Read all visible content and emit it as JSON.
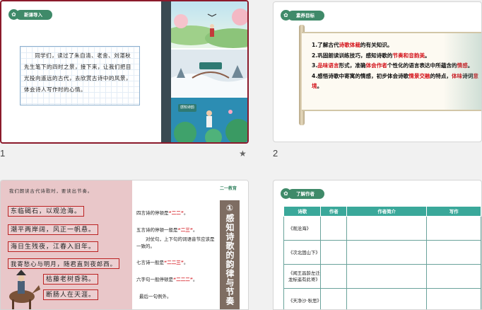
{
  "slides": [
    {
      "number": "1",
      "badge": "新课导入",
      "intro_text": "同学们，读过了朱自清、老舍、刘湛秋先生笔下的四时之景，接下来，让我们把目光投向遥远的古代，去欣赏古诗中的风景，体会诗人写作时的心情。",
      "image_labels": [
        "",
        "",
        "感知诗韵"
      ],
      "star": "★"
    },
    {
      "number": "2",
      "badge": "素养目标",
      "goals": {
        "g1_a": "1.了解古代",
        "g1_b": "诗歌体裁",
        "g1_c": "的有关知识。",
        "g2_a": "2.巩固朗读训练技巧，感知诗歌的",
        "g2_b": "节奏和音韵美",
        "g2_c": "。",
        "g3_a": "3.",
        "g3_b": "品味语言",
        "g3_c": "形式，准确",
        "g3_d": "体会作者",
        "g3_e": "个性化的语言表达中所蕴含的",
        "g3_f": "情感",
        "g3_g": "。",
        "g4_a": "4.感悟诗歌中寄寓的情感，初步体会诗歌",
        "g4_b": "情景交融",
        "g4_c": "的特点，",
        "g4_d": "体味",
        "g4_e": "诗词",
        "g4_f": "意境",
        "g4_g": "。"
      }
    },
    {
      "hint": "我们朗读古代诗歌时，要读出节奏。",
      "poem_lines": [
        "东临碣石，以观沧海。",
        "潮平两岸阔，风正一帆悬。",
        "海日生残夜，江春入旧年。",
        "我寄愁心与明月，随君直到夜郎西。",
        "枯藤老树昏鸦。",
        "断肠人在天涯。"
      ],
      "rules": [
        {
          "a": "四言诗的停顿是",
          "b": "“二二”",
          "c": "。"
        },
        {
          "a": "五言诗的停顿一般是",
          "b": "“二三”",
          "c": "。"
        },
        {
          "a": "对仗句，上下句的词语音节应该是一致的。",
          "b": "",
          "c": ""
        },
        {
          "a": "七言诗一般是",
          "b": "“二二三”",
          "c": "。"
        },
        {
          "a": "六字句一般停顿是",
          "b": "“二二二”",
          "c": "。"
        },
        {
          "a": "最后一句例外。",
          "b": "",
          "c": ""
        }
      ],
      "side_title": "①感知诗歌的韵律与节奏",
      "logo_text": "二一教育"
    },
    {
      "badge": "了解作者",
      "headers": [
        "诗歌",
        "作者",
        "作者简介",
        "写作"
      ],
      "rows": [
        "《观沧海》",
        "《次北固山下》",
        "《闻王昌龄左迁龙标遥有此寄》",
        "《天净沙·秋思》"
      ]
    }
  ],
  "colors": {
    "accent": "#3f8a69",
    "selected_border": "#8b1a2b",
    "table_header": "#3aa89a",
    "emphasis_red": "#d4141c"
  }
}
